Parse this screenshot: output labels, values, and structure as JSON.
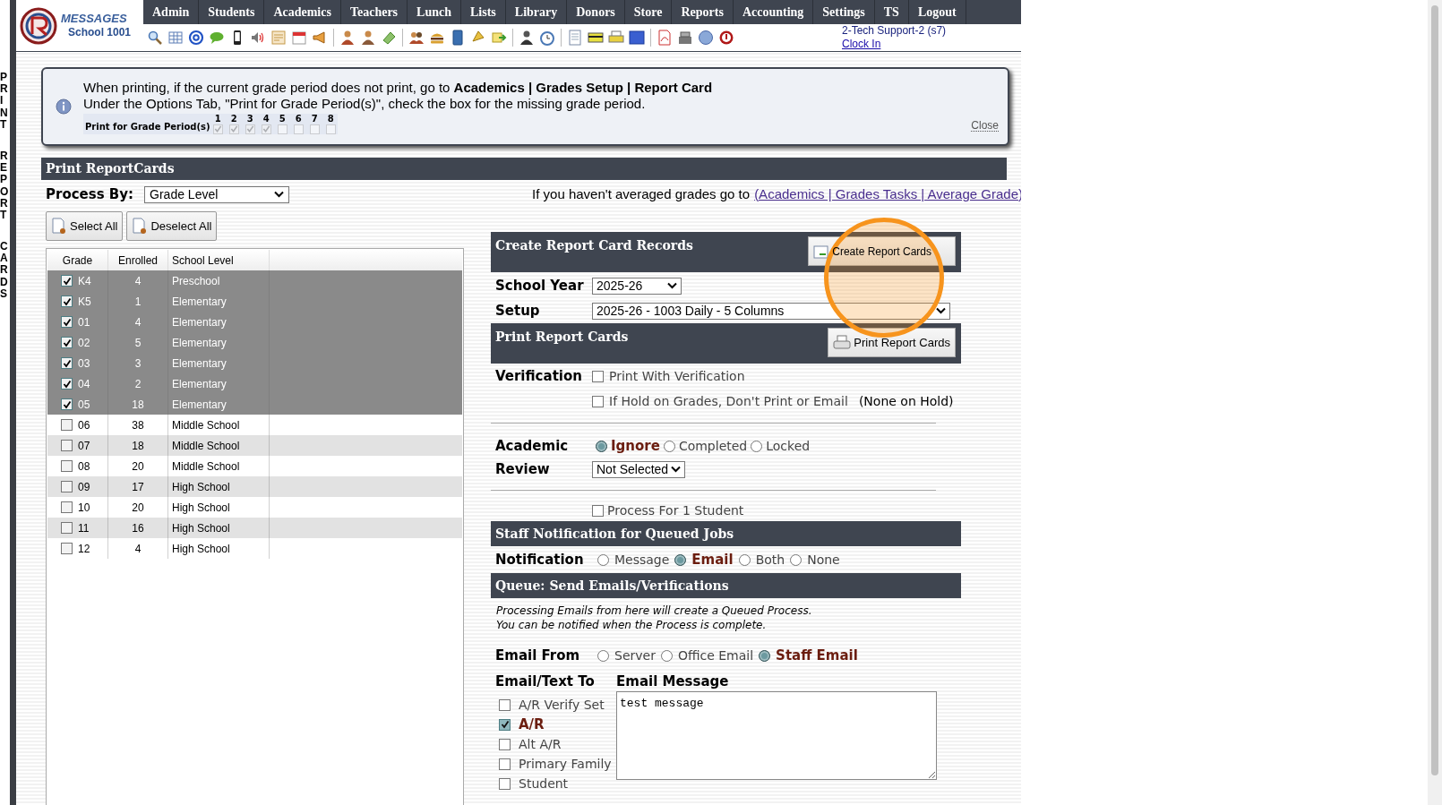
{
  "side_title": "PRINT REPORT CARDS",
  "logo": {
    "name": "MESSAGES",
    "school": "School 1001"
  },
  "nav": [
    "Admin",
    "Students",
    "Academics",
    "Teachers",
    "Lunch",
    "Lists",
    "Library",
    "Donors",
    "Store",
    "Reports",
    "Accounting",
    "Settings",
    "TS",
    "Logout"
  ],
  "user": {
    "name": "2-Tech Support-2 (s7)",
    "clock_link": "Clock In"
  },
  "notice": {
    "lines": [
      "When printing, if the current grade period does not print, go to **Academics | Grades Setup | Report Card**",
      "Under the Options Tab, \"Print for Grade Period(s)\", check the box for the missing grade period."
    ],
    "periods_label": "Print for Grade Period(s)",
    "periods": [
      {
        "label": "1",
        "checked": true
      },
      {
        "label": "2",
        "checked": true
      },
      {
        "label": "3",
        "checked": true
      },
      {
        "label": "4",
        "checked": true
      },
      {
        "label": "5",
        "checked": false
      },
      {
        "label": "6",
        "checked": false
      },
      {
        "label": "7",
        "checked": false
      },
      {
        "label": "8",
        "checked": false
      }
    ],
    "close": "Close"
  },
  "section_title": "Print ReportCards",
  "process_by": {
    "label": "Process By:",
    "value": "Grade Level"
  },
  "buttons": [
    "Select All",
    "Deselect All"
  ],
  "average_hint": {
    "text": "If you haven't averaged grades go to",
    "link": "(Academics | Grades Tasks | Average Grade)"
  },
  "grades_table": {
    "columns": [
      "Grade",
      "Enrolled",
      "School Level"
    ],
    "rows": [
      {
        "grade": "K4",
        "enrolled": "4",
        "level": "Preschool",
        "checked": true
      },
      {
        "grade": "K5",
        "enrolled": "1",
        "level": "Elementary",
        "checked": true
      },
      {
        "grade": "01",
        "enrolled": "4",
        "level": "Elementary",
        "checked": true
      },
      {
        "grade": "02",
        "enrolled": "5",
        "level": "Elementary",
        "checked": true
      },
      {
        "grade": "03",
        "enrolled": "3",
        "level": "Elementary",
        "checked": true
      },
      {
        "grade": "04",
        "enrolled": "2",
        "level": "Elementary",
        "checked": true
      },
      {
        "grade": "05",
        "enrolled": "18",
        "level": "Elementary",
        "checked": true
      },
      {
        "grade": "06",
        "enrolled": "38",
        "level": "Middle School",
        "checked": false
      },
      {
        "grade": "07",
        "enrolled": "18",
        "level": "Middle School",
        "checked": false
      },
      {
        "grade": "08",
        "enrolled": "20",
        "level": "Middle School",
        "checked": false
      },
      {
        "grade": "09",
        "enrolled": "17",
        "level": "High School",
        "checked": false
      },
      {
        "grade": "10",
        "enrolled": "20",
        "level": "High School",
        "checked": false
      },
      {
        "grade": "11",
        "enrolled": "16",
        "level": "High School",
        "checked": false
      },
      {
        "grade": "12",
        "enrolled": "4",
        "level": "High School",
        "checked": false
      }
    ]
  },
  "create_panel": {
    "title": "Create Report Card Records",
    "button": "Create Report Cards"
  },
  "school_year": {
    "label": "School Year",
    "value": "2025-26"
  },
  "setup": {
    "label": "Setup",
    "value": "2025-26 - 1003 Daily - 5 Columns"
  },
  "print_panel": {
    "title": "Print Report Cards",
    "button": "Print Report Cards"
  },
  "verification": {
    "label": "Verification",
    "options": [
      {
        "label": "Print With Verification",
        "checked": false
      },
      {
        "label": "If Hold on Grades, Don't Print or Email",
        "checked": false
      }
    ],
    "hold_note": "(None on Hold)"
  },
  "academic": {
    "label": "Academic",
    "options": [
      {
        "label": "Ignore",
        "selected": true
      },
      {
        "label": "Completed",
        "selected": false
      },
      {
        "label": "Locked",
        "selected": false
      }
    ]
  },
  "review": {
    "label": "Review",
    "value": "Not Selected"
  },
  "single_student": {
    "label": "Process For 1 Student",
    "checked": false
  },
  "staff_notification": {
    "title": "Staff Notification for Queued Jobs",
    "label": "Notification",
    "options": [
      {
        "label": "Message",
        "selected": false
      },
      {
        "label": "Email",
        "selected": true
      },
      {
        "label": "Both",
        "selected": false
      },
      {
        "label": "None",
        "selected": false
      }
    ]
  },
  "queue": {
    "title": "Queue: Send Emails/Verifications",
    "notes": [
      "Processing Emails from here will create a Queued Process.",
      "You can be notified when the Process is complete."
    ],
    "email_from": {
      "label": "Email From",
      "options": [
        {
          "label": "Server",
          "selected": false
        },
        {
          "label": "Office Email",
          "selected": false
        },
        {
          "label": "Staff Email",
          "selected": true
        }
      ]
    },
    "recipients": {
      "label": "Email/Text To",
      "options": [
        {
          "label": "A/R Verify Set",
          "checked": false
        },
        {
          "label": "A/R",
          "checked": true
        },
        {
          "label": "Alt A/R",
          "checked": false
        },
        {
          "label": "Primary Family",
          "checked": false
        },
        {
          "label": "Student",
          "checked": false
        }
      ]
    },
    "message": {
      "label": "Email Message",
      "value": "test message"
    }
  }
}
